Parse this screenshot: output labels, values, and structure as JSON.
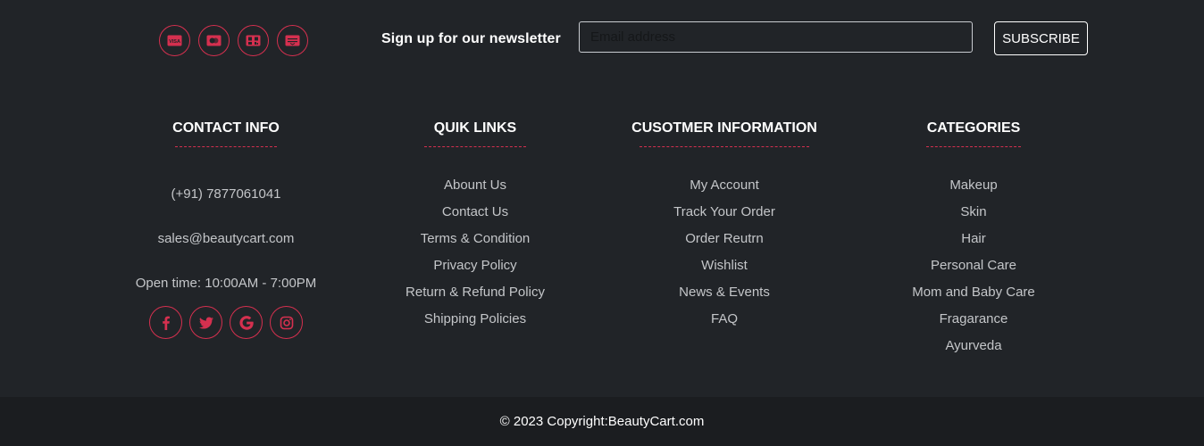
{
  "payment_icons": [
    "visa-icon",
    "mastercard-icon",
    "qr-code-icon",
    "bank-transfer-icon"
  ],
  "newsletter": {
    "label": "Sign up for our newsletter",
    "placeholder": "Email address",
    "button": "SUBSCRIBE"
  },
  "contact": {
    "heading": "CONTACT INFO",
    "phone": "(+91) 7877061041",
    "email": "sales@beautycart.com",
    "hours": "Open time: 10:00AM - 7:00PM",
    "social_icons": [
      "facebook-icon",
      "twitter-icon",
      "google-icon",
      "instagram-icon"
    ]
  },
  "quick_links": {
    "heading": "QUIK LINKS",
    "items": [
      "Abount Us",
      "Contact Us",
      "Terms & Condition",
      "Privacy Policy",
      "Return & Refund Policy",
      "Shipping Policies"
    ]
  },
  "customer_info": {
    "heading": "CUSOTMER INFORMATION",
    "items": [
      "My Account",
      "Track Your Order",
      "Order Reutrn",
      "Wishlist",
      "News & Events",
      "FAQ"
    ]
  },
  "categories": {
    "heading": "CATEGORIES",
    "items": [
      "Makeup",
      "Skin",
      "Hair",
      "Personal Care",
      "Mom and Baby Care",
      "Fragarance",
      "Ayurveda"
    ]
  },
  "footer": {
    "copyright": "© 2023 Copyright:BeautyCart.com"
  },
  "colors": {
    "background": "#212428",
    "bottom_bar": "#1b1d20",
    "accent": "#d5304f",
    "link_text": "#c4c6c9"
  }
}
